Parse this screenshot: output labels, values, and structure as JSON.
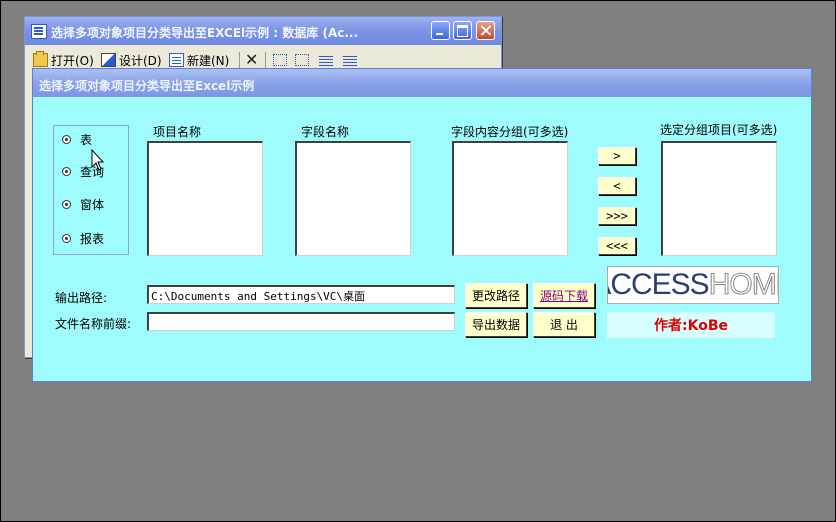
{
  "back_window": {
    "title": "选择多项对象项目分类导出至EXCEl示例 : 数据库 (Ac...",
    "toolbar": {
      "open_label": "打开(O)",
      "design_label": "设计(D)",
      "new_label": "新建(N)",
      "icons": [
        "open-icon",
        "design-icon",
        "new-icon",
        "delete-icon",
        "small-icons-icon",
        "list-icon",
        "details-icon",
        "grid-icon"
      ]
    }
  },
  "dialog": {
    "title": "选择多项对象项目分类导出至Excel示例",
    "object_types": [
      "表",
      "查询",
      "窗体",
      "报表"
    ],
    "columns": {
      "item_name": "项目名称",
      "field_name": "字段名称",
      "field_group": "字段内容分组(可多选)",
      "selected_group": "选定分组项目(可多选)"
    },
    "move_buttons": {
      "add_one": ">",
      "remove_one": "<",
      "add_all": ">>>",
      "remove_all": "<<<"
    },
    "output_path_label": "输出路径:",
    "output_path_value": "C:\\Documents and Settings\\VC\\桌面",
    "prefix_label": "文件名称前缀:",
    "prefix_value": "",
    "change_path_label": "更改路径",
    "download_link": "源码下载",
    "export_label": "导出数据",
    "exit_label": "退  出",
    "logo": {
      "part1": "ACCESS",
      "part2": "HOME"
    },
    "author": "作者:KoBe"
  },
  "colors": {
    "dialog_bg": "#9FFCFC",
    "desktop_bg": "#808080",
    "button_bg": "#FFFFCC",
    "author_text": "#E00000"
  }
}
